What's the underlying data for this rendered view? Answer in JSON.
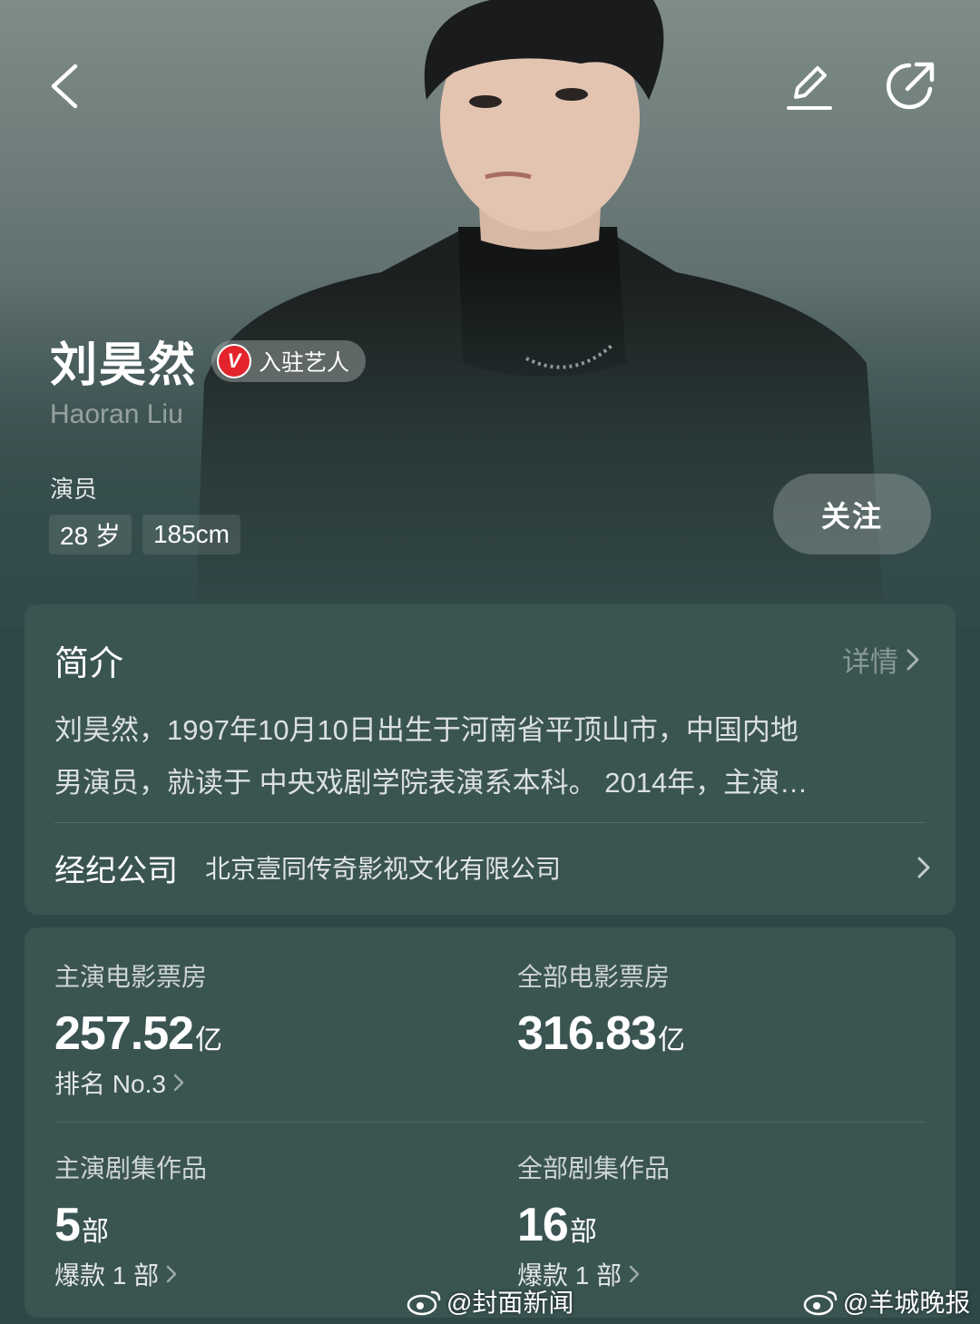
{
  "artist": {
    "name": "刘昊然",
    "badge_text": "入驻艺人",
    "english_name": "Haoran Liu",
    "profession": "演员",
    "tags": [
      "28 岁",
      "185cm"
    ],
    "follow_label": "关注"
  },
  "intro": {
    "title": "简介",
    "detail_label": "详情",
    "text_line1": "刘昊然，1997年10月10日出生于河南省平顶山市，中国内地",
    "text_line2": "男演员，就读于 中央戏剧学院表演系本科。 2014年，主演…",
    "agency_label": "经纪公司",
    "agency_value": "北京壹同传奇影视文化有限公司"
  },
  "stats": {
    "lead_box_office": {
      "label": "主演电影票房",
      "value": "257.52",
      "unit": "亿",
      "sub": "排名 No.3"
    },
    "total_box_office": {
      "label": "全部电影票房",
      "value": "316.83",
      "unit": "亿"
    },
    "lead_series": {
      "label": "主演剧集作品",
      "value": "5",
      "unit": "部",
      "sub": "爆款 1 部"
    },
    "total_series": {
      "label": "全部剧集作品",
      "value": "16",
      "unit": "部",
      "sub": "爆款 1 部"
    }
  },
  "watermarks": [
    "@封面新闻",
    "@羊城晚报"
  ]
}
